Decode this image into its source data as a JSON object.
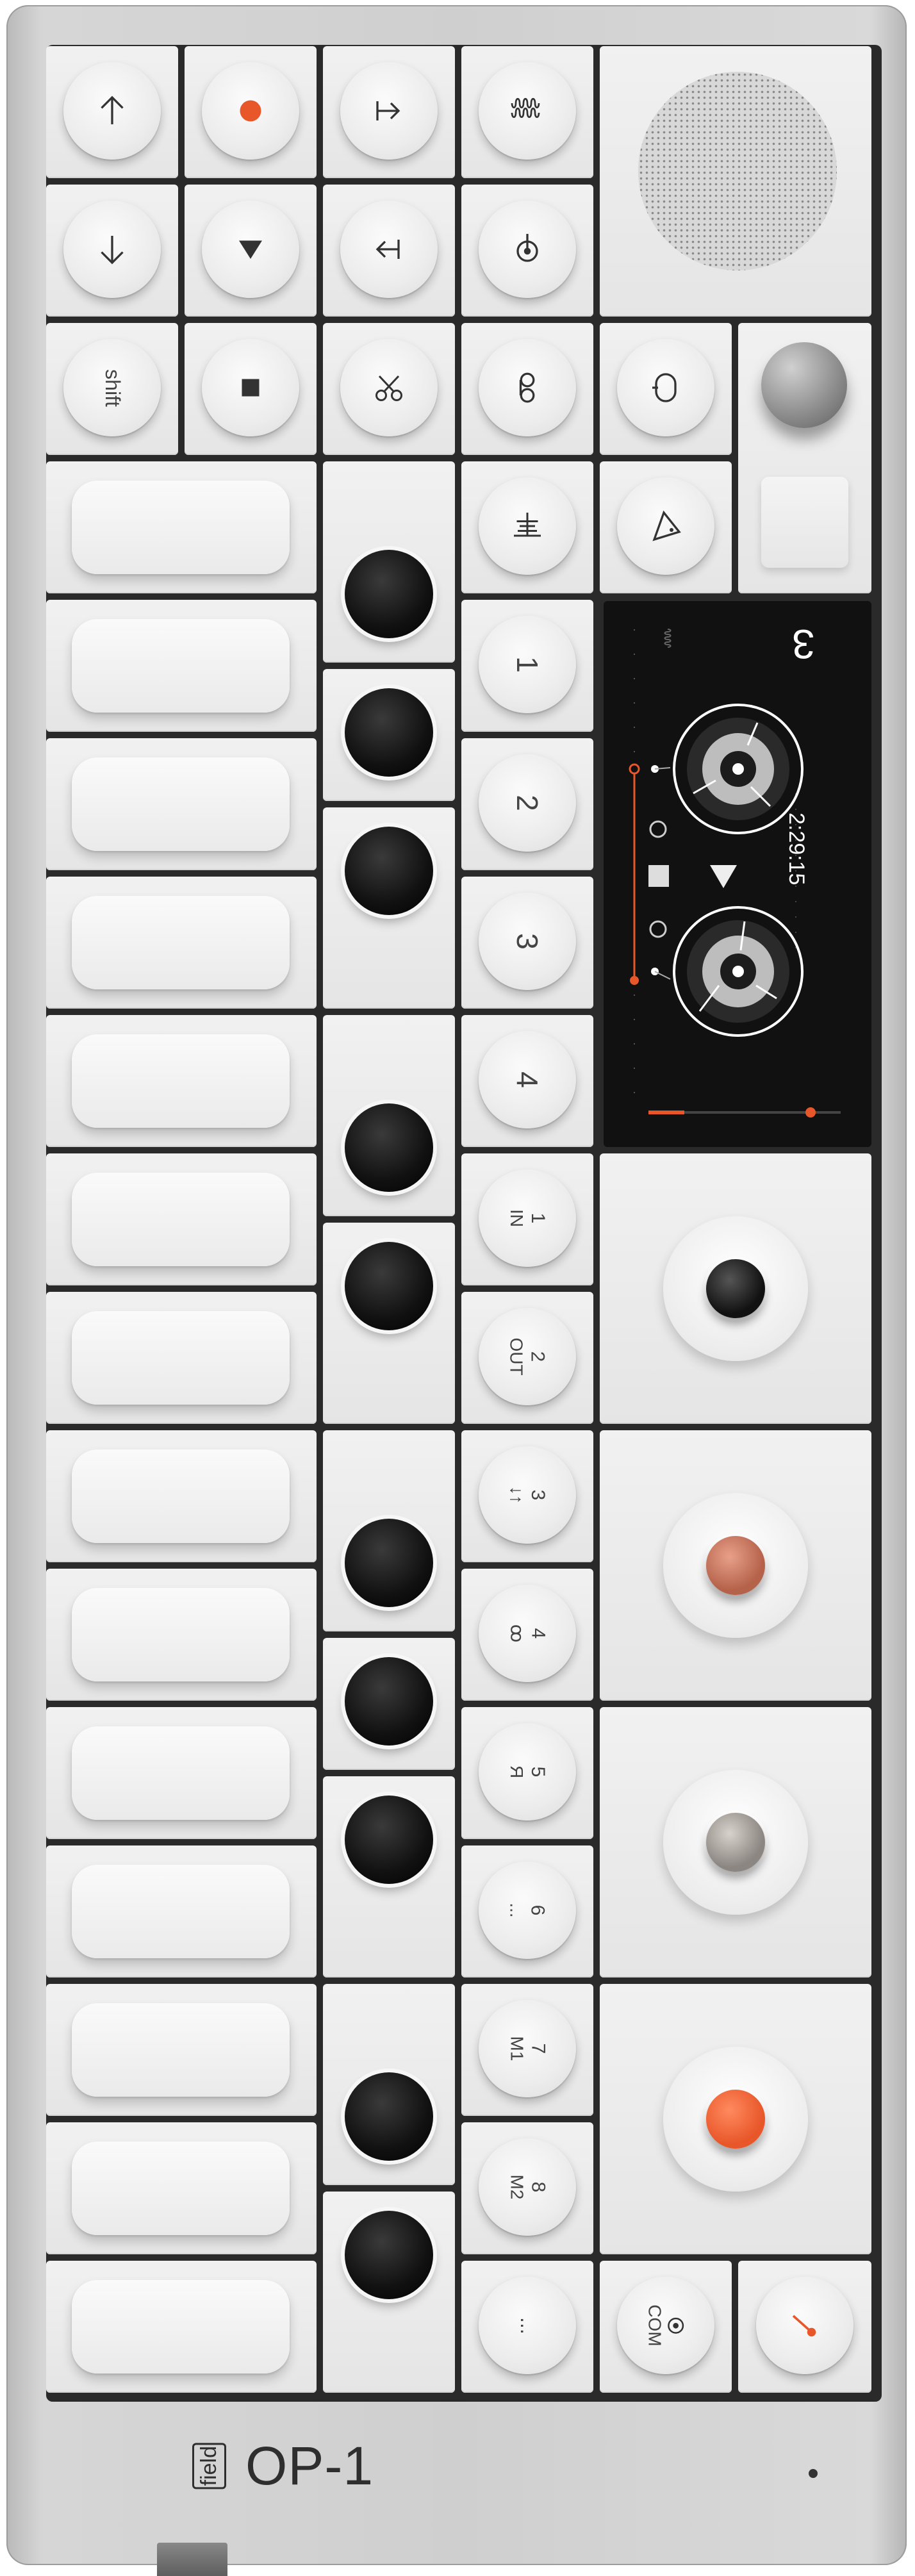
{
  "device": {
    "model": "OP-1",
    "edition": "field"
  },
  "transport_keys": {
    "shift": "shift"
  },
  "number_keys": [
    {
      "num": "1",
      "sub": ""
    },
    {
      "num": "2",
      "sub": ""
    },
    {
      "num": "3",
      "sub": ""
    },
    {
      "num": "4",
      "sub": ""
    },
    {
      "num": "1",
      "sub": "IN"
    },
    {
      "num": "2",
      "sub": "OUT"
    },
    {
      "num": "3",
      "sub": "↓↑"
    },
    {
      "num": "4",
      "sub": "ꝏ"
    },
    {
      "num": "5",
      "sub": "Я"
    },
    {
      "num": "6",
      "sub": "..."
    },
    {
      "num": "7",
      "sub": "M1"
    },
    {
      "num": "8",
      "sub": "M2"
    }
  ],
  "bottom_keys": {
    "dots": "...",
    "com": "COM"
  },
  "screen": {
    "track_number": "3",
    "time": "2:29:15",
    "progress": 0.85
  },
  "colors": {
    "accent_orange": "#e8572a",
    "knob_blue": "#1a1a1a",
    "knob_green": "#b5624a",
    "knob_white": "#8c8682",
    "knob_orange": "#e8572a"
  },
  "icons": {
    "up": "arrow-up-icon",
    "record": "record-icon",
    "jump_end": "jump-end-icon",
    "wave": "wave-icon",
    "down": "arrow-down-icon",
    "play": "play-icon",
    "jump_start": "jump-start-icon",
    "pin": "pin-icon",
    "stop": "stop-icon",
    "scissors": "scissors-icon",
    "tape": "tape-icon",
    "mic": "microphone-icon",
    "eq": "equalizer-icon",
    "speaker_mode": "speaker-mode-icon",
    "metronome": "metronome-icon"
  }
}
